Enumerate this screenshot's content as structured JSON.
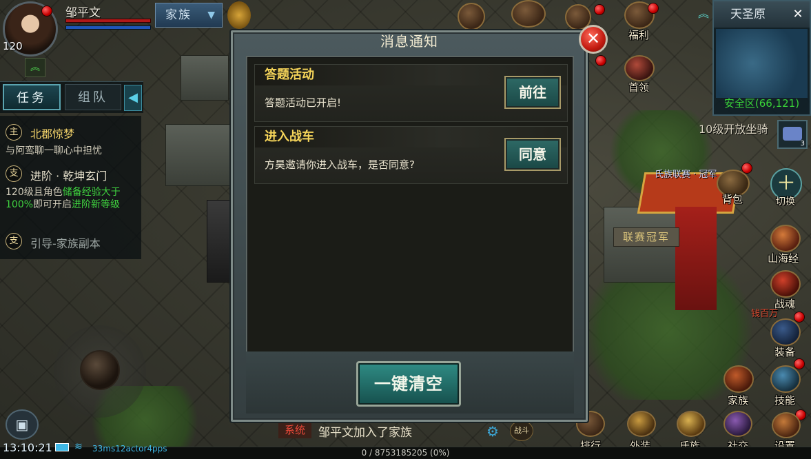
{
  "player": {
    "name": "邹平文",
    "level": "120",
    "family_tab": "家族"
  },
  "quest_tabs": {
    "task": "任务",
    "team": "组队"
  },
  "quests": [
    {
      "badge": "主",
      "title": "北郡惊梦",
      "desc": "与阿鸾聊一聊心中担忧"
    },
    {
      "badge": "支",
      "title": "进阶 · 乾坤玄门",
      "desc_pre": "120级且角色",
      "desc_green1": "储备经验大于100%",
      "desc_mid": "即可开启",
      "desc_green2": "进阶新等级"
    },
    {
      "badge": "支",
      "title": "引导-家族副本"
    }
  ],
  "top_icons": {
    "welfare": "福利",
    "boss": "首领"
  },
  "minimap": {
    "name": "天圣原",
    "safe_zone": "安全区(66,121)"
  },
  "mount_tip": "10级开放坐骑",
  "mount_count": "3",
  "scene_text": {
    "banner": "氏族联赛 · 冠军",
    "signboard": "联赛冠军",
    "npc": "钱百万"
  },
  "right_menu": {
    "bag": "背包",
    "switch": "切换",
    "shanhai": "山海经",
    "soul": "战魂",
    "equip": "装备",
    "family": "家族",
    "skill": "技能"
  },
  "bottom_menu": {
    "rank": "排行",
    "appearance": "外装",
    "clan": "氏族",
    "social": "社交",
    "settings": "设置"
  },
  "dialog": {
    "title": "消息通知",
    "messages": [
      {
        "title": "答题活动",
        "text": "答题活动已开启!",
        "button": "前往"
      },
      {
        "title": "进入战车",
        "text": "方昊邀请你进入战车，是否同意?",
        "button": "同意"
      }
    ],
    "clear_all": "一键清空"
  },
  "chat": {
    "channel": "系统",
    "text": "邹平文加入了家族",
    "battle_tag": "战斗"
  },
  "status": {
    "time": "13:10:21",
    "net": "33ms12actor4pps",
    "exp": "0 / 8753185205 (0%)"
  },
  "colors": {
    "accent_gold": "#f6d55a",
    "safe_green": "#39d239",
    "quest_green": "#3fd23f",
    "button_teal": "#2e6a66"
  }
}
